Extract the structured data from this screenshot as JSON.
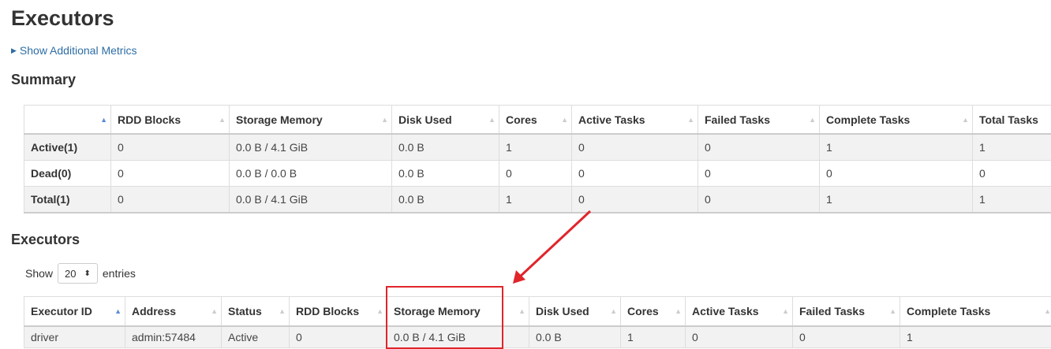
{
  "page": {
    "title": "Executors",
    "additional_metrics_label": "Show Additional Metrics"
  },
  "summary": {
    "title": "Summary",
    "headers": [
      "",
      "RDD Blocks",
      "Storage Memory",
      "Disk Used",
      "Cores",
      "Active Tasks",
      "Failed Tasks",
      "Complete Tasks",
      "Total Tasks"
    ],
    "rows": [
      [
        "Active(1)",
        "0",
        "0.0 B / 4.1 GiB",
        "0.0 B",
        "1",
        "0",
        "0",
        "1",
        "1"
      ],
      [
        "Dead(0)",
        "0",
        "0.0 B / 0.0 B",
        "0.0 B",
        "0",
        "0",
        "0",
        "0",
        "0"
      ],
      [
        "Total(1)",
        "0",
        "0.0 B / 4.1 GiB",
        "0.0 B",
        "1",
        "0",
        "0",
        "1",
        "1"
      ]
    ]
  },
  "executors": {
    "title": "Executors",
    "length_control": {
      "show_label": "Show",
      "selected": "20",
      "entries_label": "entries"
    },
    "headers": [
      "Executor ID",
      "Address",
      "Status",
      "RDD Blocks",
      "Storage Memory",
      "Disk Used",
      "Cores",
      "Active Tasks",
      "Failed Tasks",
      "Complete Tasks"
    ],
    "rows": [
      [
        "driver",
        "admin:57484",
        "Active",
        "0",
        "0.0 B / 4.1 GiB",
        "0.0 B",
        "1",
        "0",
        "0",
        "1"
      ]
    ]
  },
  "annotation": {
    "color": "#e0252b",
    "highlighted_column": "Storage Memory"
  },
  "icons": {
    "sort_both": "sort-both-icon",
    "sort_asc": "sort-asc-icon",
    "expand": "triangle-right-icon",
    "select_arrow": "select-updown-icon"
  },
  "colors": {
    "link": "#2e6da4",
    "row_stripe": "#f2f2f2",
    "sort_active": "#5b8bd6"
  }
}
